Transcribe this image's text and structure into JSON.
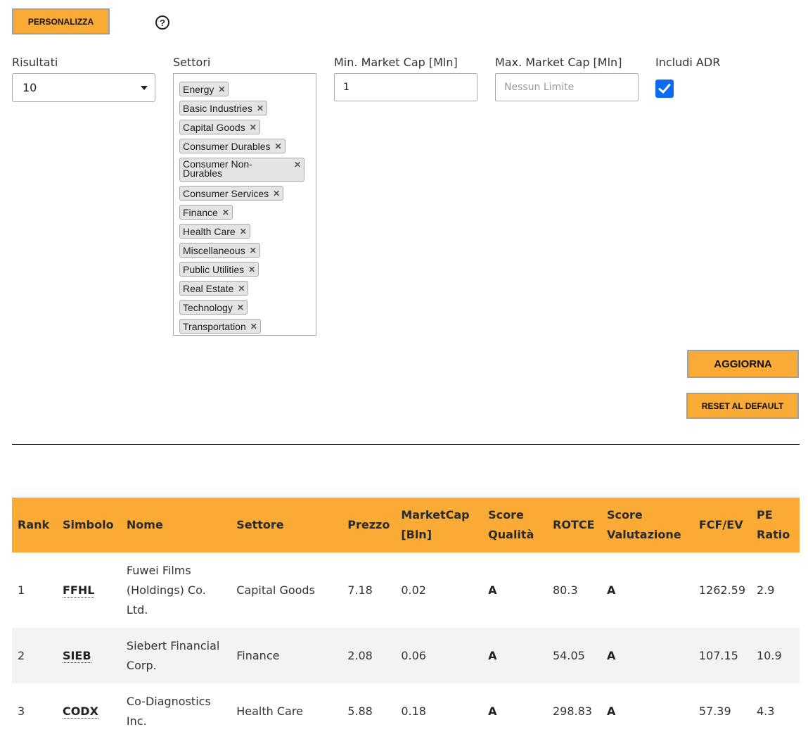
{
  "header": {
    "personalize_label": "PERSONALIZZA",
    "help_icon": "question-circle-icon"
  },
  "filters": {
    "results": {
      "label": "Risultati",
      "value": "10"
    },
    "sectors": {
      "label": "Settori",
      "tags": [
        "Energy",
        "Basic Industries",
        "Capital Goods",
        "Consumer Durables",
        "Consumer Non-Durables",
        "Consumer Services",
        "Finance",
        "Health Care",
        "Miscellaneous",
        "Public Utilities",
        "Real Estate",
        "Technology",
        "Transportation"
      ]
    },
    "min_market_cap": {
      "label": "Min. Market Cap [Mln]",
      "value": "1"
    },
    "max_market_cap": {
      "label": "Max. Market Cap [Mln]",
      "placeholder": "Nessun Limite"
    },
    "adr": {
      "label": "Includi ADR",
      "checked": true
    }
  },
  "actions": {
    "update_label": "AGGIORNA",
    "reset_label": "RESET AL DEFAULT"
  },
  "colors": {
    "accent": "#faab36",
    "checkbox": "#0b6bf3"
  },
  "table": {
    "headers": [
      "Rank",
      "Simbolo",
      "Nome",
      "Settore",
      "Prezzo",
      "MarketCap [Bln]",
      "Score Qualità",
      "ROTCE",
      "Score Valutazione",
      "FCF/EV",
      "PE Ratio"
    ],
    "rows": [
      [
        "1",
        "FFHL",
        "Fuwei Films (Holdings) Co. Ltd.",
        "Capital Goods",
        "7.18",
        "0.02",
        "A",
        "80.3",
        "A",
        "1262.59",
        "2.9"
      ],
      [
        "2",
        "SIEB",
        "Siebert Financial Corp.",
        "Finance",
        "2.08",
        "0.06",
        "A",
        "54.05",
        "A",
        "107.15",
        "10.9"
      ],
      [
        "3",
        "CODX",
        "Co-Diagnostics Inc.",
        "Health Care",
        "5.88",
        "0.18",
        "A",
        "298.83",
        "A",
        "57.39",
        "4.3"
      ]
    ]
  }
}
